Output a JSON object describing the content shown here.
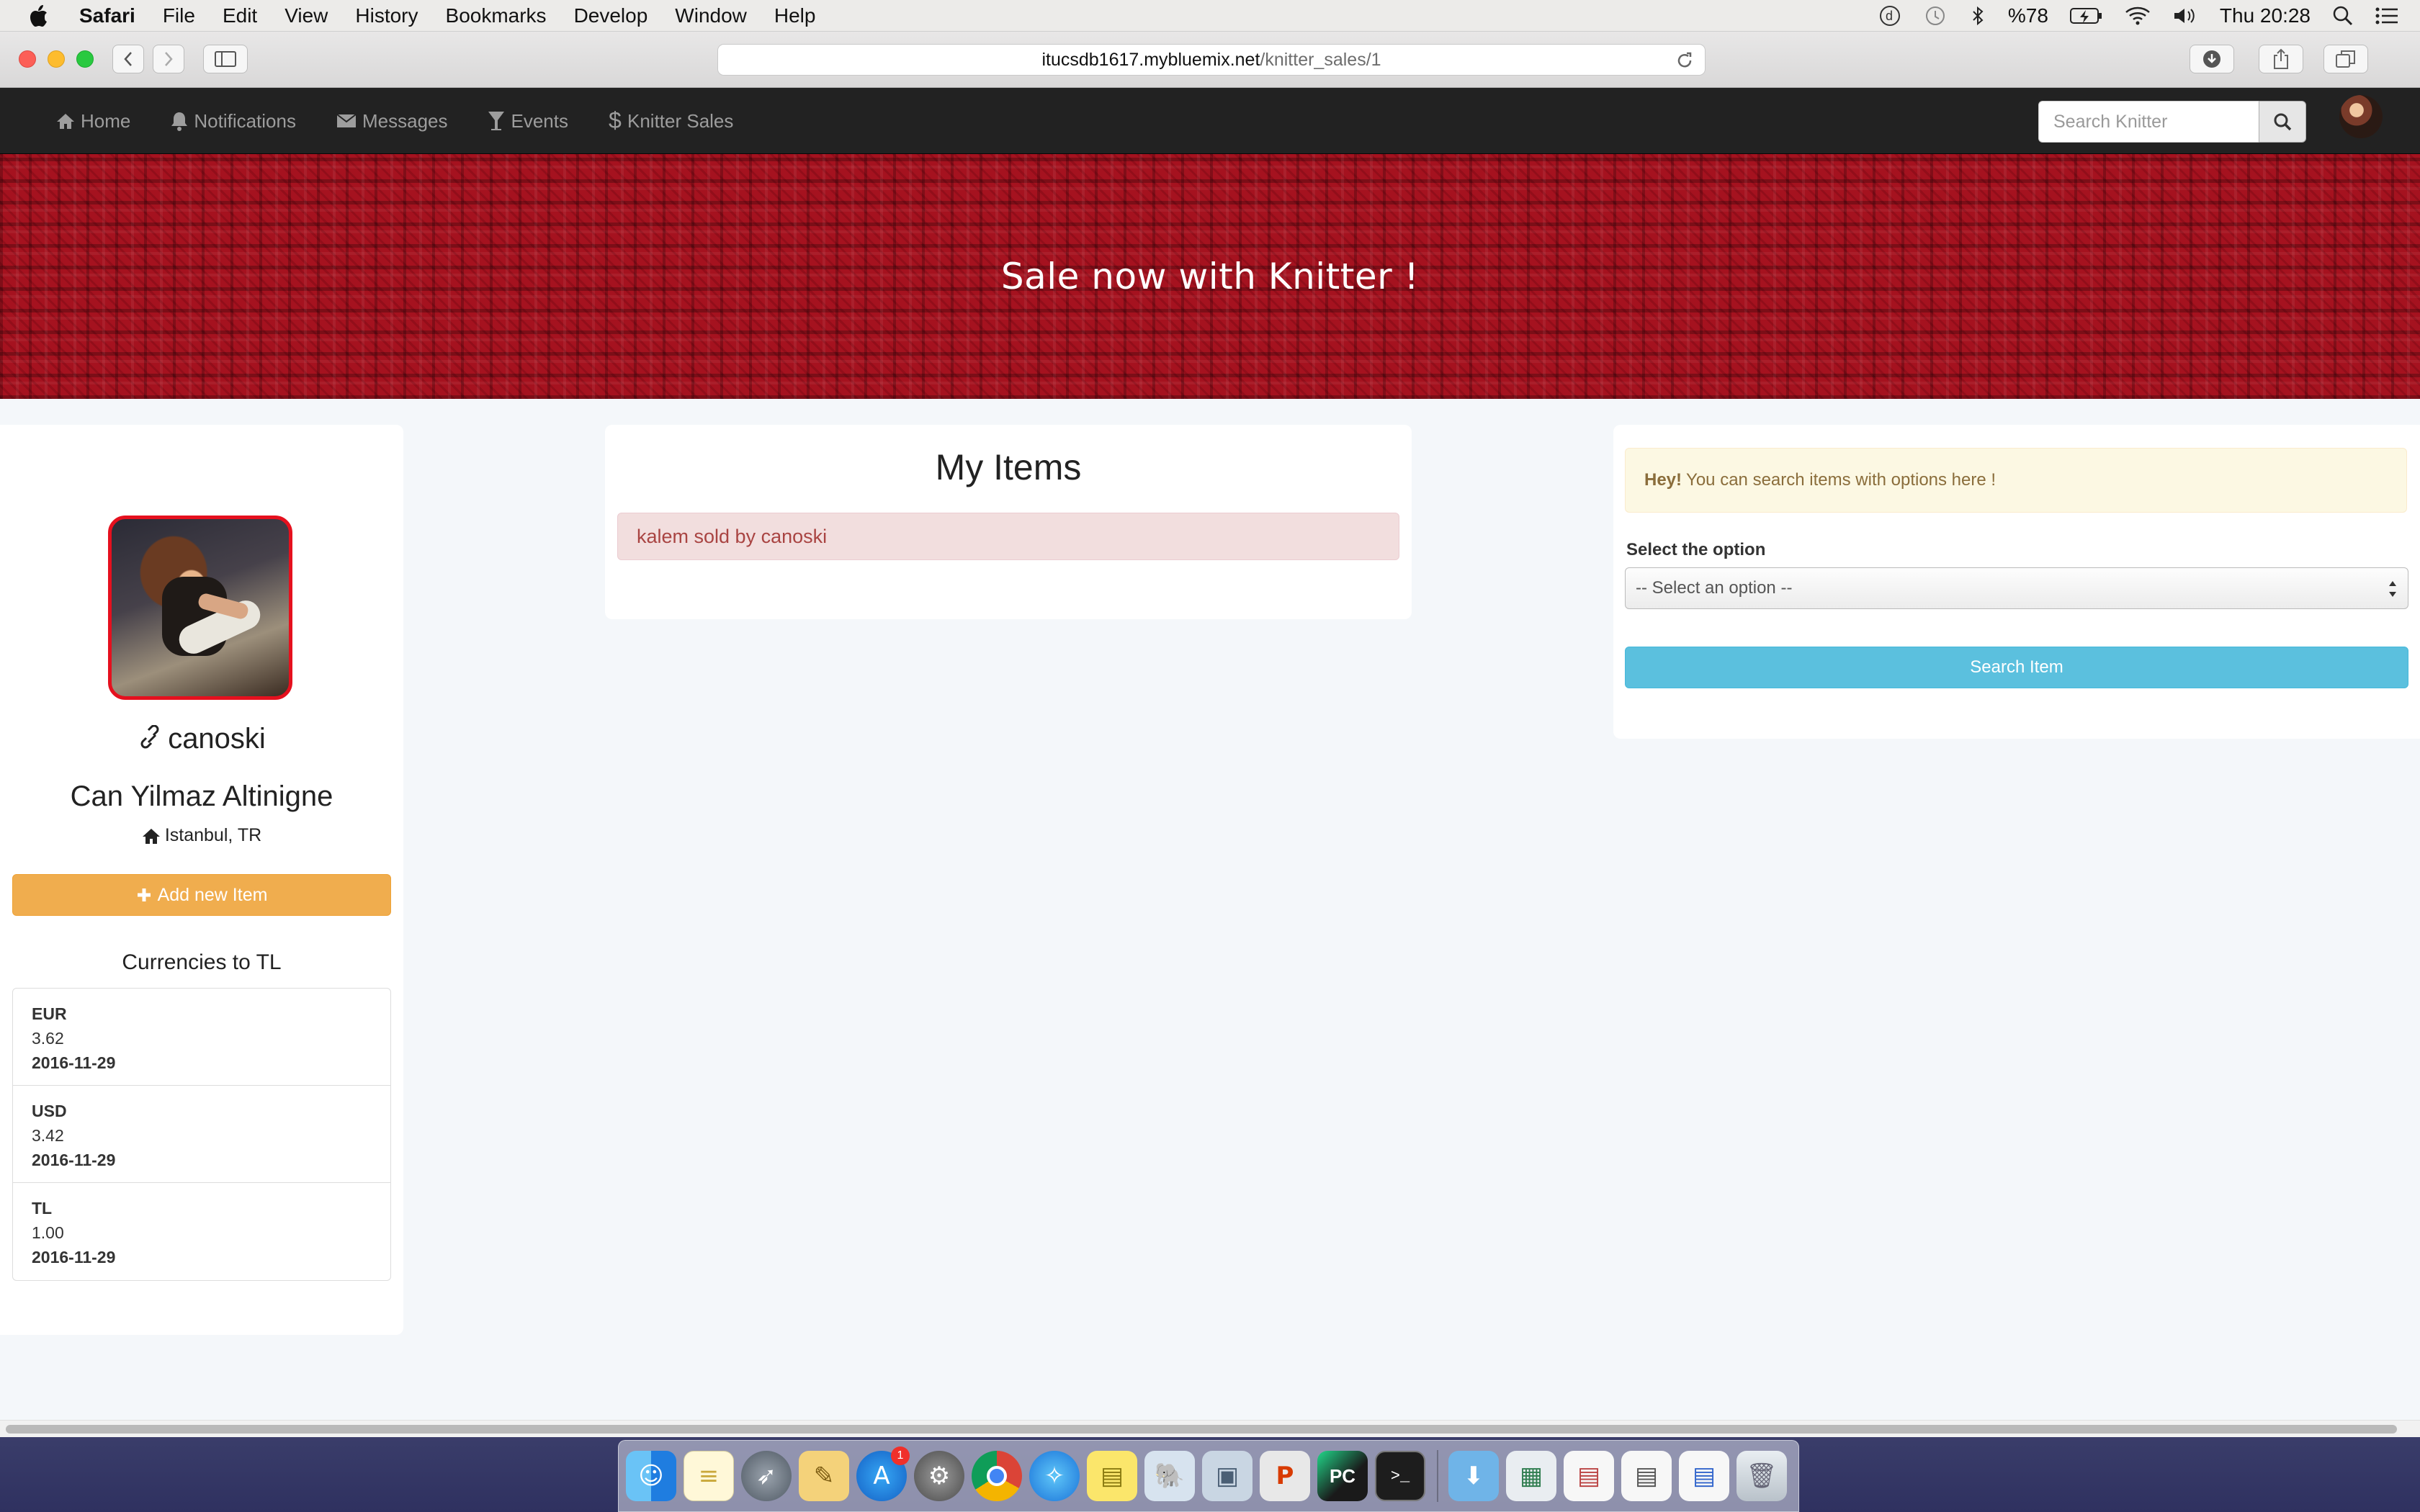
{
  "menubar": {
    "app_name": "Safari",
    "items": [
      "File",
      "Edit",
      "View",
      "History",
      "Bookmarks",
      "Develop",
      "Window",
      "Help"
    ],
    "battery": "%78",
    "clock": "Thu 20:28"
  },
  "browser": {
    "url_host": "itucsdb1617.mybluemix.net",
    "url_path": "/knitter_sales/1"
  },
  "nav": {
    "links": [
      {
        "label": "Home",
        "icon": "home-icon"
      },
      {
        "label": "Notifications",
        "icon": "bell-icon"
      },
      {
        "label": "Messages",
        "icon": "envelope-icon"
      },
      {
        "label": "Events",
        "icon": "glass-icon"
      },
      {
        "label": "Knitter Sales",
        "icon": "dollar-icon"
      }
    ],
    "search_placeholder": "Search Knitter"
  },
  "banner": {
    "title": "Sale now with Knitter !"
  },
  "profile": {
    "username": "canoski",
    "full_name": "Can Yilmaz Altinigne",
    "location": "Istanbul, TR",
    "add_button": "Add new Item"
  },
  "currencies": {
    "title": "Currencies to TL",
    "items": [
      {
        "code": "EUR",
        "rate": "3.62",
        "date": "2016-11-29"
      },
      {
        "code": "USD",
        "rate": "3.42",
        "date": "2016-11-29"
      },
      {
        "code": "TL",
        "rate": "1.00",
        "date": "2016-11-29"
      }
    ]
  },
  "my_items": {
    "title": "My Items",
    "items": [
      "kalem sold by canoski"
    ]
  },
  "search_panel": {
    "hint_bold": "Hey!",
    "hint_text": "You can search items with options here !",
    "select_label": "Select the option",
    "select_value": "-- Select an option --",
    "button": "Search Item"
  },
  "dock": {
    "app_store_badge": "1"
  },
  "colors": {
    "navbar": "#222222",
    "banner": "#a5121f",
    "warning_button": "#f0ad4e",
    "info_button": "#5bc0de",
    "danger_alert_bg": "#f2dede",
    "warning_alert_bg": "#fcf8e3",
    "profile_border": "#e5101e"
  }
}
